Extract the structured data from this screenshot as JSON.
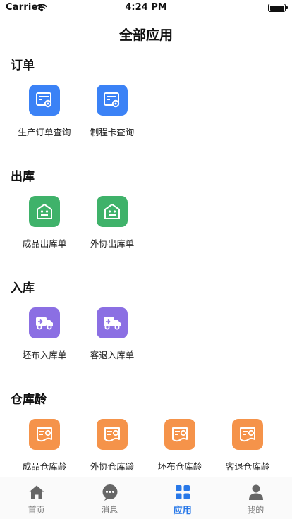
{
  "status_bar": {
    "carrier": "Carrier",
    "time": "4:24 PM"
  },
  "page_title": "全部应用",
  "sections": [
    {
      "title": "订单",
      "apps": [
        {
          "label": "生产订单查询",
          "icon": "order-card-icon",
          "color": "#3b82f6"
        },
        {
          "label": "制程卡查询",
          "icon": "process-card-icon",
          "color": "#3b82f6"
        }
      ]
    },
    {
      "title": "出库",
      "apps": [
        {
          "label": "成品出库单",
          "icon": "warehouse-out-icon",
          "color": "#3fb26a"
        },
        {
          "label": "外协出库单",
          "icon": "warehouse-out-icon",
          "color": "#3fb26a"
        }
      ]
    },
    {
      "title": "入库",
      "apps": [
        {
          "label": "坯布入库单",
          "icon": "truck-icon",
          "color": "#8b6fe3"
        },
        {
          "label": "客退入库单",
          "icon": "truck-icon",
          "color": "#8b6fe3"
        }
      ]
    },
    {
      "title": "仓库龄",
      "apps": [
        {
          "label": "成品仓库龄",
          "icon": "inventory-age-icon",
          "color": "#f5934a"
        },
        {
          "label": "外协仓库龄",
          "icon": "inventory-age-icon",
          "color": "#f5934a"
        },
        {
          "label": "坯布仓库龄",
          "icon": "inventory-age-icon",
          "color": "#f5934a"
        },
        {
          "label": "客退仓库龄",
          "icon": "inventory-age-icon",
          "color": "#f5934a"
        }
      ]
    }
  ],
  "tab_bar": {
    "active_color": "#2878e8",
    "tabs": [
      {
        "label": "首页",
        "icon": "home-icon",
        "active": false
      },
      {
        "label": "消息",
        "icon": "message-icon",
        "active": false
      },
      {
        "label": "应用",
        "icon": "apps-grid-icon",
        "active": true
      },
      {
        "label": "我的",
        "icon": "profile-icon",
        "active": false
      }
    ]
  }
}
